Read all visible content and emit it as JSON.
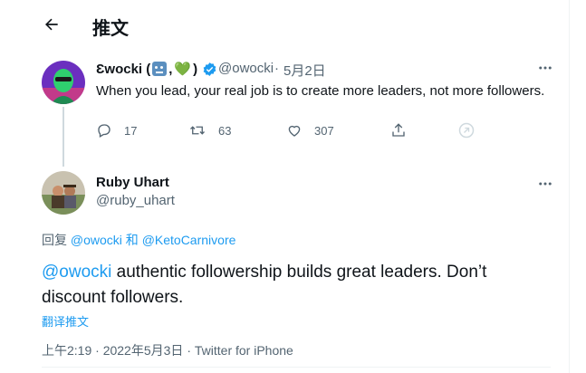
{
  "header": {
    "title": "推文"
  },
  "parent_tweet": {
    "name_prefix": "Ɛwocki (",
    "name_mid": ",",
    "name_suffix": ")",
    "emoji_heart": "💚",
    "handle": "@owocki",
    "separator": "·",
    "date": "5月2日",
    "text": "When you lead, your real job is to create more leaders, not more followers.",
    "replies": "17",
    "retweets": "63",
    "likes": "307"
  },
  "reply_tweet": {
    "name": "Ruby Uhart",
    "handle": "@ruby_uhart",
    "replying_label": "回复",
    "replying_mention_1": "@owocki",
    "replying_and": "和",
    "replying_mention_2": "@KetoCarnivore",
    "mention": "@owocki",
    "text_rest": " authentic followership builds great leaders. Don’t discount followers.",
    "translate_label": "翻译推文",
    "time": "上午2:19",
    "date": "2022年5月3日",
    "meta_separator": "·",
    "source": "Twitter for iPhone"
  },
  "colors": {
    "accent": "#1d9bf0",
    "secondary_text": "#536471",
    "verified": "#1d9bf0"
  },
  "icons": [
    "back-arrow-icon",
    "verified-badge-icon",
    "more-icon",
    "reply-icon",
    "retweet-icon",
    "like-icon",
    "share-icon",
    "tip-icon"
  ]
}
